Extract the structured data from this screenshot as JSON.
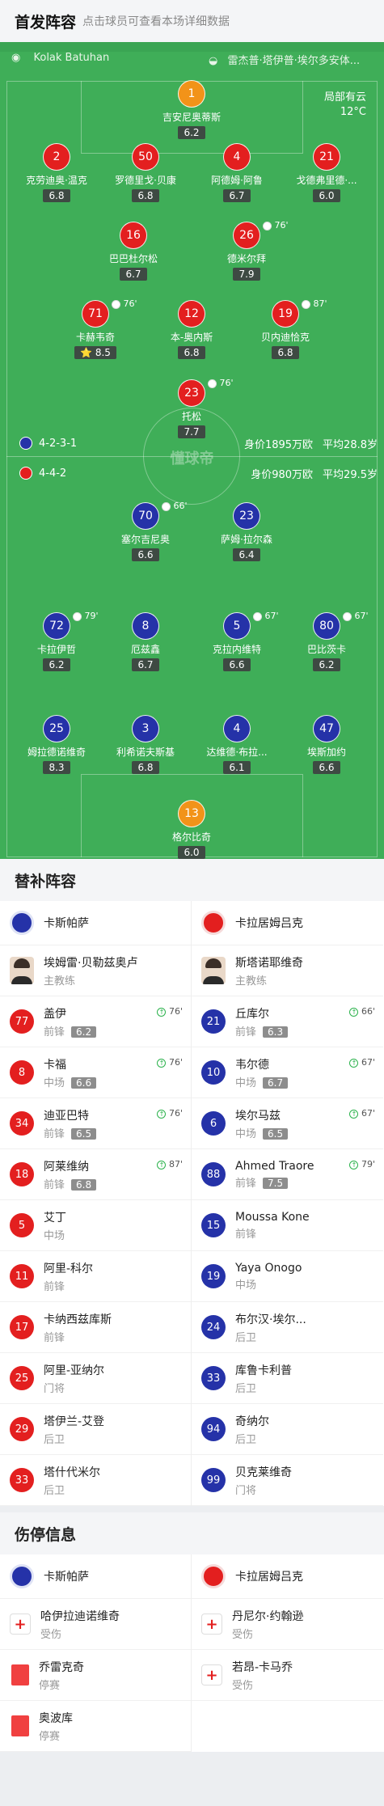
{
  "header": {
    "title": "首发阵容",
    "subtitle": "点击球员可查看本场详细数据"
  },
  "pitch": {
    "stadium": "Kolak Batuhan",
    "referee": "雷杰普·塔伊普·埃尔多安体...",
    "weather": "局部有云",
    "temp": "12°C",
    "watermark": "懂球帝",
    "home_team": {
      "formation": "4-2-3-1",
      "value": "身价1895万欧",
      "age": "平均28.8岁"
    },
    "away_team": {
      "formation": "4-4-2",
      "value": "身价980万欧",
      "age": "平均29.5岁"
    }
  },
  "players": [
    {
      "num": "1",
      "name": "吉安尼奥蒂斯",
      "rating": "6.2",
      "team": "gk"
    },
    {
      "num": "2",
      "name": "克劳迪奥·温克",
      "rating": "6.8",
      "team": "red"
    },
    {
      "num": "50",
      "name": "罗德里戈·贝康",
      "rating": "6.8",
      "team": "red"
    },
    {
      "num": "4",
      "name": "阿德姆·阿鲁",
      "rating": "6.7",
      "team": "red"
    },
    {
      "num": "21",
      "name": "戈德弗里德·...",
      "rating": "6.0",
      "team": "red"
    },
    {
      "num": "16",
      "name": "巴巴杜尔松",
      "rating": "6.7",
      "team": "red"
    },
    {
      "num": "26",
      "name": "德米尔拜",
      "rating": "7.9",
      "team": "red",
      "event": "76'"
    },
    {
      "num": "71",
      "name": "卡赫韦奇",
      "rating": "8.5",
      "team": "red",
      "event": "76'",
      "star": "⭐"
    },
    {
      "num": "12",
      "name": "本-奥内斯",
      "rating": "6.8",
      "team": "red"
    },
    {
      "num": "19",
      "name": "贝内迪恰克",
      "rating": "6.8",
      "team": "red",
      "event": "87'"
    },
    {
      "num": "23",
      "name": "托松",
      "rating": "7.7",
      "team": "red",
      "event": "76'"
    },
    {
      "num": "70",
      "name": "塞尔吉尼奥",
      "rating": "6.6",
      "team": "blue",
      "event": "66'"
    },
    {
      "num": "23",
      "name": "萨姆·拉尔森",
      "rating": "6.4",
      "team": "blue"
    },
    {
      "num": "72",
      "name": "卡拉伊哲",
      "rating": "6.2",
      "team": "blue",
      "event": "79'"
    },
    {
      "num": "8",
      "name": "厄兹鑫",
      "rating": "6.7",
      "team": "blue"
    },
    {
      "num": "5",
      "name": "克拉内维特",
      "rating": "6.6",
      "team": "blue",
      "event": "67'"
    },
    {
      "num": "80",
      "name": "巴比茨卡",
      "rating": "6.2",
      "team": "blue",
      "event": "67'"
    },
    {
      "num": "25",
      "name": "姆拉德诺维奇",
      "rating": "8.3",
      "team": "blue"
    },
    {
      "num": "3",
      "name": "利希诺夫斯基",
      "rating": "6.8",
      "team": "blue"
    },
    {
      "num": "4",
      "name": "达维德·布拉...",
      "rating": "6.1",
      "team": "blue"
    },
    {
      "num": "47",
      "name": "埃斯加约",
      "rating": "6.6",
      "team": "blue"
    },
    {
      "num": "13",
      "name": "格尔比奇",
      "rating": "6.0",
      "team": "gk"
    }
  ],
  "subs": {
    "title": "替补阵容",
    "home_name": "卡斯帕萨",
    "away_name": "卡拉居姆吕克",
    "home_coach": {
      "name": "埃姆雷·贝勒兹奥卢",
      "role": "主教练"
    },
    "away_coach": {
      "name": "斯塔诺耶维奇",
      "role": "主教练"
    },
    "home": [
      {
        "num": "77",
        "name": "盖伊",
        "pos": "前锋",
        "rating": "6.2",
        "min": "76'"
      },
      {
        "num": "8",
        "name": "卡福",
        "pos": "中场",
        "rating": "6.6",
        "min": "76'"
      },
      {
        "num": "34",
        "name": "迪亚巴特",
        "pos": "前锋",
        "rating": "6.5",
        "min": "76'"
      },
      {
        "num": "18",
        "name": "阿莱维纳",
        "pos": "前锋",
        "rating": "6.8",
        "min": "87'"
      },
      {
        "num": "5",
        "name": "艾丁",
        "pos": "中场"
      },
      {
        "num": "11",
        "name": "阿里-科尔",
        "pos": "前锋"
      },
      {
        "num": "17",
        "name": "卡纳西兹库斯",
        "pos": "前锋"
      },
      {
        "num": "25",
        "name": "阿里-亚纳尔",
        "pos": "门将"
      },
      {
        "num": "29",
        "name": "塔伊兰-艾登",
        "pos": "后卫"
      },
      {
        "num": "33",
        "name": "塔什代米尔",
        "pos": "后卫"
      }
    ],
    "away": [
      {
        "num": "21",
        "name": "丘库尔",
        "pos": "前锋",
        "rating": "6.3",
        "min": "66'"
      },
      {
        "num": "10",
        "name": "韦尔德",
        "pos": "中场",
        "rating": "6.7",
        "min": "67'"
      },
      {
        "num": "6",
        "name": "埃尔马兹",
        "pos": "中场",
        "rating": "6.5",
        "min": "67'"
      },
      {
        "num": "88",
        "name": "Ahmed Traore",
        "pos": "前锋",
        "rating": "7.5",
        "min": "79'"
      },
      {
        "num": "15",
        "name": "Moussa Kone",
        "pos": "前锋"
      },
      {
        "num": "19",
        "name": "Yaya Onogo",
        "pos": "中场"
      },
      {
        "num": "24",
        "name": "布尔汉·埃尔...",
        "pos": "后卫"
      },
      {
        "num": "33",
        "name": "库鲁卡利普",
        "pos": "后卫"
      },
      {
        "num": "94",
        "name": "奇纳尔",
        "pos": "后卫"
      },
      {
        "num": "99",
        "name": "贝克莱维奇",
        "pos": "门将"
      }
    ]
  },
  "injuries": {
    "title": "伤停信息",
    "home_name": "卡斯帕萨",
    "away_name": "卡拉居姆吕克",
    "home": [
      {
        "name": "哈伊拉迪诺维奇",
        "status": "受伤",
        "kind": "injury"
      },
      {
        "name": "乔雷克奇",
        "status": "停赛",
        "kind": "suspension"
      },
      {
        "name": "奥波库",
        "status": "停赛",
        "kind": "suspension"
      }
    ],
    "away": [
      {
        "name": "丹尼尔·约翰逊",
        "status": "受伤",
        "kind": "injury"
      },
      {
        "name": "若昂-卡马乔",
        "status": "受伤",
        "kind": "injury"
      }
    ]
  },
  "colors": {
    "home": "#e31f1f",
    "away": "#2532a8",
    "gk": "#f29319",
    "pitch": "#3fae58"
  }
}
